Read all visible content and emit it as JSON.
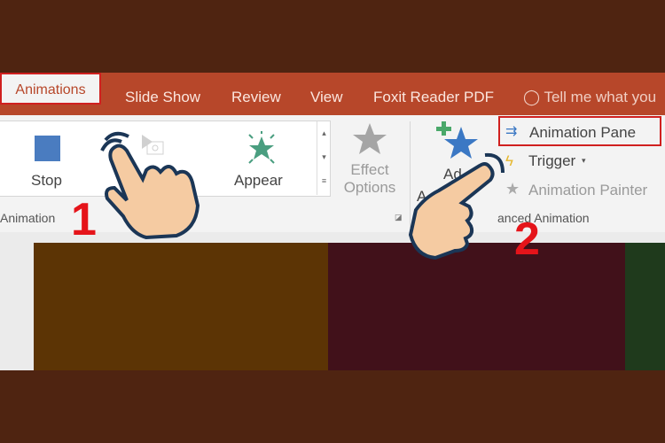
{
  "tabs": [
    {
      "label": "Animations",
      "active": true
    },
    {
      "label": "Slide Show"
    },
    {
      "label": "Review"
    },
    {
      "label": "View"
    },
    {
      "label": "Foxit Reader PDF"
    }
  ],
  "tell_me": "Tell me what you",
  "ribbon": {
    "stop": "Stop",
    "appear": "Appear",
    "effect_options_1": "Effect",
    "effect_options_2": "Options",
    "group_animation": "Animation",
    "add_partial": "Ad",
    "add_partial_2": "A",
    "animation_pane": "Animation Pane",
    "trigger": "Trigger",
    "animation_painter": "Animation Painter",
    "group_advanced_partial": "anced Animation"
  },
  "annotations": {
    "step1": "1",
    "step2": "2"
  },
  "colors": {
    "accent": "#b7472a",
    "highlight": "#d0201f",
    "step": "#e5141a",
    "slide1": "#5c3405",
    "slide2": "#41111a",
    "slide3": "#1f3a1c"
  }
}
